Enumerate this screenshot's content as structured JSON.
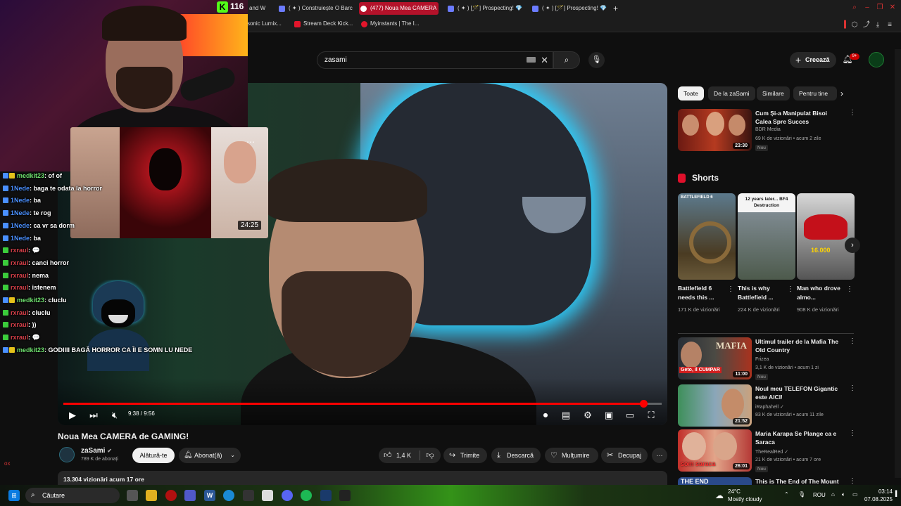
{
  "browser": {
    "tabs": [
      {
        "label": "and W"
      },
      {
        "label": "( ✦ ) Construiește O Barc"
      },
      {
        "label": "(477) Noua Mea CAMERA",
        "active": true
      },
      {
        "label": "( ✦ ) [🪄] Prospecting! 💎"
      },
      {
        "label": "( ✦ ) [🪄] Prospecting! 💎"
      }
    ],
    "new_tab": "+",
    "bookmarks": [
      {
        "label": "sonic Lumix..."
      },
      {
        "label": "Stream Deck Kick..."
      },
      {
        "label": "Myinstants | The I..."
      }
    ]
  },
  "stream_overlay": {
    "kick_logo": "K",
    "viewer_count": "116",
    "chat": [
      {
        "user": "medkit23",
        "msg": ": of of",
        "color": "#6ee06e",
        "badge": "mod-sword"
      },
      {
        "user": "1Nede",
        "msg": ": baga te odata la horror",
        "color": "#4a90ff",
        "badge": "sub"
      },
      {
        "user": "1Nede",
        "msg": ": ba",
        "color": "#4a90ff",
        "badge": "sub"
      },
      {
        "user": "1Nede",
        "msg": ": te rog",
        "color": "#4a90ff",
        "badge": "sub"
      },
      {
        "user": "1Nede",
        "msg": ": ca vr sa dorm",
        "color": "#4a90ff",
        "badge": "sub"
      },
      {
        "user": "1Nede",
        "msg": ": ba",
        "color": "#4a90ff",
        "badge": "sub"
      },
      {
        "user": "rxraul",
        "msg": ": 💬",
        "color": "#d9404a",
        "badge": "vip"
      },
      {
        "user": "rxraul",
        "msg": ": canci horror",
        "color": "#d9404a",
        "badge": "vip"
      },
      {
        "user": "rxraul",
        "msg": ": nema",
        "color": "#d9404a",
        "badge": "vip"
      },
      {
        "user": "rxraul",
        "msg": ": istenem",
        "color": "#d9404a",
        "badge": "vip"
      },
      {
        "user": "medkit23",
        "msg": ": cluclu",
        "color": "#6ee06e",
        "badge": "mod-sword"
      },
      {
        "user": "rxraul",
        "msg": ": cluclu",
        "color": "#d9404a",
        "badge": "vip"
      },
      {
        "user": "rxraul",
        "msg": ": ))",
        "color": "#d9404a",
        "badge": "vip"
      },
      {
        "user": "rxraul",
        "msg": ": 💬",
        "color": "#d9404a",
        "badge": "vip"
      },
      {
        "user": "medkit23",
        "msg": ": GODIIII BAGĂ HORROR CA ÎI E SOMN LU NEDE",
        "color": "#6ee06e",
        "badge": "mod-sword"
      }
    ],
    "miniplayer_duration": "24:25",
    "miniplayer_menu": "⋯",
    "footer_tag": "ox"
  },
  "youtube": {
    "search_value": "zasami",
    "create_label": "Creează",
    "notif_count": "9+",
    "player": {
      "current_time": "9:38",
      "duration": "9:56",
      "progress": 0.969
    },
    "video": {
      "title": "Noua Mea CAMERA de GAMING!",
      "channel": "zaSami",
      "subscribers": "789 K de abonați",
      "join_label": "Alătură-te",
      "subscribed_label": "Abonat(ă)",
      "likes": "1,4 K",
      "share_label": "Trimite",
      "download_label": "Descarcă",
      "thanks_label": "Mulțumire",
      "clip_label": "Decupaj",
      "views_line": "13.304 vizionări  acum 17 ore"
    },
    "chips": [
      {
        "label": "Toate",
        "selected": true
      },
      {
        "label": "De la zaSami"
      },
      {
        "label": "Similare"
      },
      {
        "label": "Pentru tine"
      }
    ],
    "recommended_top": {
      "title": "Cum Și-a Manipulat Bisoi Calea Spre Succes",
      "channel": "BDR Media",
      "meta": "69 K de vizionări • acum 2 zile",
      "badge": "Nou",
      "duration": "23:30"
    },
    "shorts_label": "Shorts",
    "shorts": [
      {
        "title": "Battlefield 6 needs this ...",
        "views": "171 K de vizionări",
        "overlay": "BATTLEFIELD 6"
      },
      {
        "title": "This is why Battlefield ...",
        "views": "224 K de vizionări",
        "overlay": "12 years later... BF4 Destruction"
      },
      {
        "title": "Man who drove almo...",
        "views": "908 K de vizionări",
        "overlay": "16.000"
      }
    ],
    "recommended": [
      {
        "title": "Ultimul trailer de la Mafia The Old Country",
        "channel": "Frizea",
        "meta": "3,1 K de vizionări • acum 1 zi",
        "badge": "Nou",
        "duration": "11:00",
        "thumb_text": "Geto, il CUMPAR",
        "thumb_brand": "MAFIA"
      },
      {
        "title": "Noul meu TELEFON Gigantic este AICI!",
        "channel": "iRaphahell ✓",
        "meta": "83 K de vizionări • acum 11 zile",
        "badge": "",
        "duration": "21:52",
        "thumb_text": "",
        "thumb_brand": ""
      },
      {
        "title": "Maria Karapa Se Plange ca e Saraca",
        "channel": "TheRealRed ✓",
        "meta": "21 K de vizionări • acum 7 ore",
        "badge": "Nou",
        "duration": "26:01",
        "thumb_text": "som saraca",
        "thumb_brand": ""
      },
      {
        "title": "This is The End of The Mount",
        "channel": "",
        "meta": "",
        "badge": "",
        "duration": "",
        "thumb_text": "THE END",
        "thumb_brand": ""
      }
    ]
  },
  "taskbar": {
    "search_label": "Căutare",
    "weather_temp": "24°C",
    "weather_desc": "Mostly cloudy",
    "lang": "ROU",
    "time": "03:14",
    "date": "07.08.2025"
  },
  "colors": {
    "accent": "#ff0000",
    "kick_green": "#53fc18",
    "tab_active": "#b3122a"
  }
}
